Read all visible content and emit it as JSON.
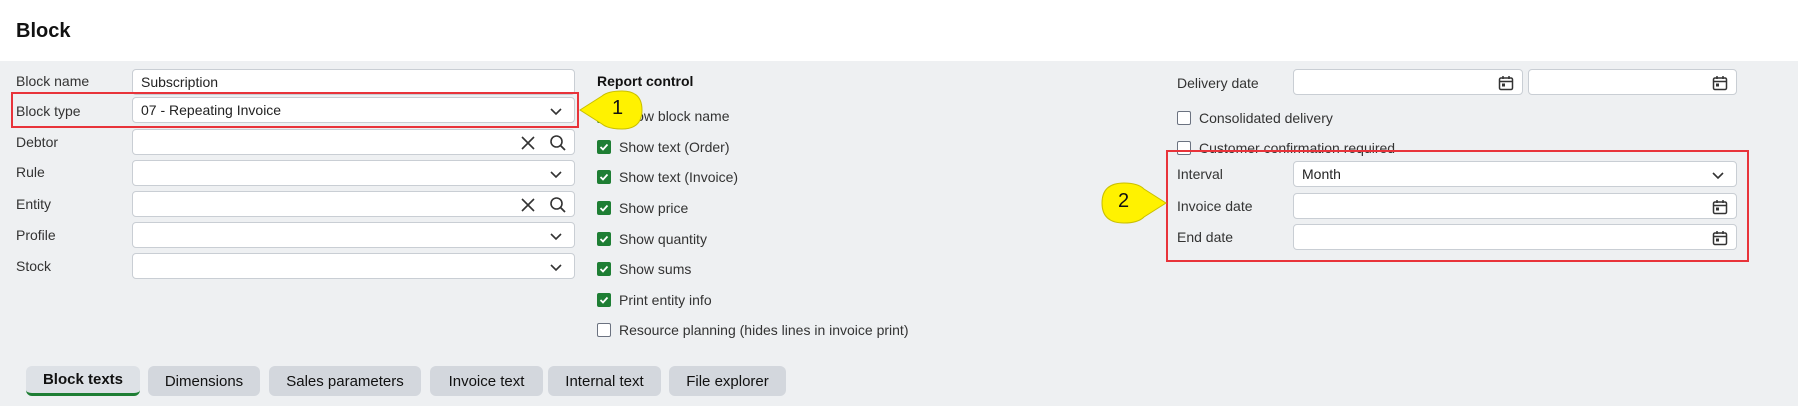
{
  "page": {
    "title": "Block"
  },
  "form": {
    "block_name": {
      "label": "Block name",
      "value": "Subscription"
    },
    "block_type": {
      "label": "Block type",
      "value": "07 - Repeating Invoice"
    },
    "debtor": {
      "label": "Debtor",
      "value": ""
    },
    "rule": {
      "label": "Rule",
      "value": ""
    },
    "entity": {
      "label": "Entity",
      "value": ""
    },
    "profile": {
      "label": "Profile",
      "value": ""
    },
    "stock": {
      "label": "Stock",
      "value": ""
    }
  },
  "report_control": {
    "heading": "Report control",
    "items": [
      {
        "label": "Show block name",
        "checked": true
      },
      {
        "label": "Show text (Order)",
        "checked": true
      },
      {
        "label": "Show text (Invoice)",
        "checked": true
      },
      {
        "label": "Show price",
        "checked": true
      },
      {
        "label": "Show quantity",
        "checked": true
      },
      {
        "label": "Show sums",
        "checked": true
      },
      {
        "label": "Print entity info",
        "checked": true
      },
      {
        "label": "Resource planning (hides lines in invoice print)",
        "checked": false
      }
    ]
  },
  "delivery": {
    "delivery_date": {
      "label": "Delivery date",
      "from": "",
      "to": ""
    },
    "consolidated_delivery": {
      "label": "Consolidated delivery",
      "checked": false
    },
    "customer_confirmation": {
      "label": "Customer confirmation required",
      "checked": false
    },
    "interval": {
      "label": "Interval",
      "value": "Month"
    },
    "invoice_date": {
      "label": "Invoice date",
      "value": ""
    },
    "end_date": {
      "label": "End date",
      "value": ""
    }
  },
  "callouts": {
    "one": "1",
    "two": "2"
  },
  "tabs": [
    {
      "label": "Block texts",
      "active": true
    },
    {
      "label": "Dimensions",
      "active": false
    },
    {
      "label": "Sales parameters",
      "active": false
    },
    {
      "label": "Invoice text",
      "active": false
    },
    {
      "label": "Internal text",
      "active": false
    },
    {
      "label": "File explorer",
      "active": false
    }
  ],
  "colors": {
    "accent_green": "#1e7e34",
    "highlight_red": "#e8333a",
    "callout_yellow": "#fff200"
  }
}
